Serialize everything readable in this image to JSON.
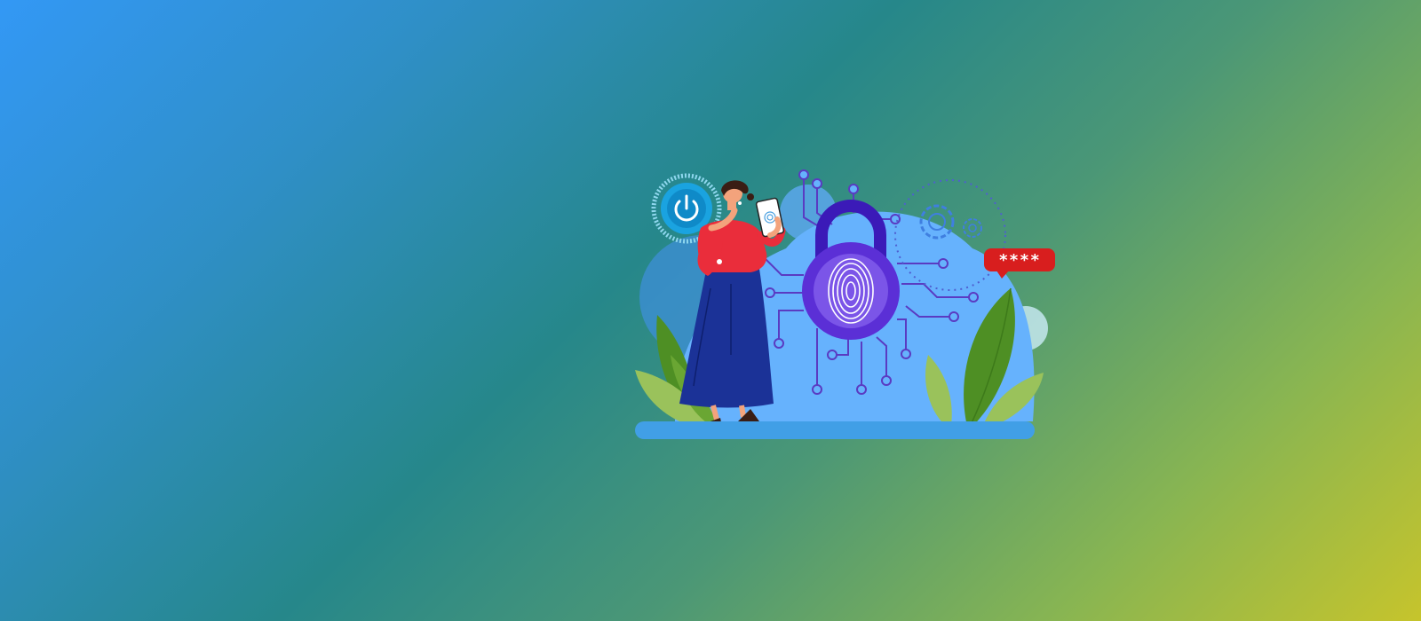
{
  "illustration": {
    "password_bubble": "****"
  },
  "colors": {
    "background_start": "#3398f5",
    "background_mid": "#26878a",
    "background_end": "#c6c42c",
    "cloud": "#66b2fd",
    "lock": "#5b2fd6",
    "circuit": "#5a3bc2",
    "dress_shirt": "#ea2d3b",
    "skirt": "#1b3297",
    "leaf": "#5f9a2b",
    "bubble": "#d81e1e"
  },
  "icons": [
    "power-icon",
    "fingerprint-icon",
    "padlock-icon",
    "gear-icon",
    "smartphone-icon",
    "leaf-icon"
  ]
}
